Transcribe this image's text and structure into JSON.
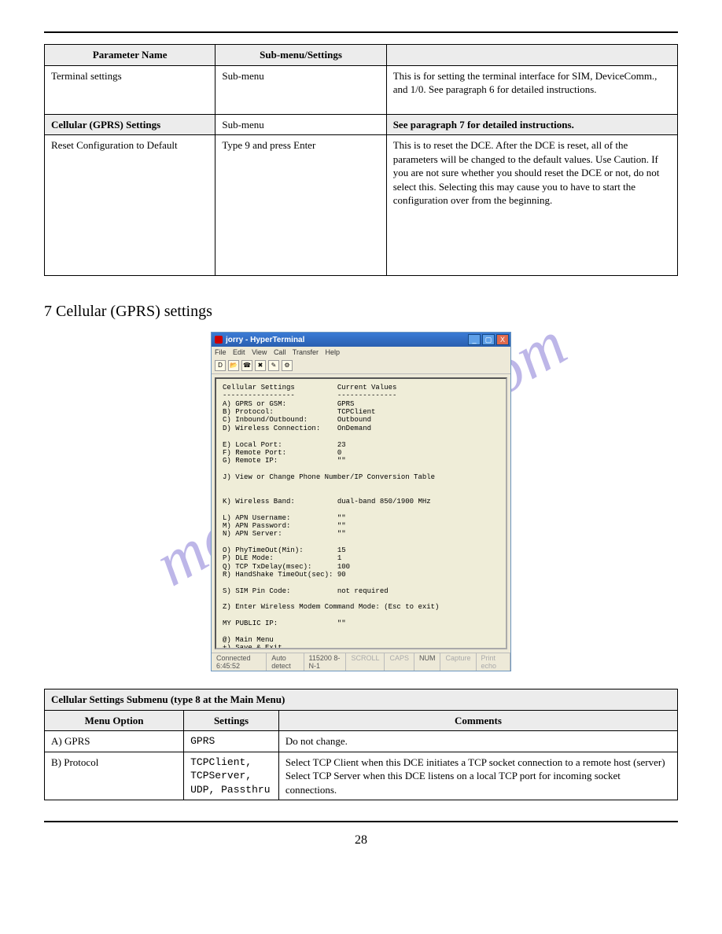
{
  "page_number": "28",
  "table1": {
    "headers": [
      "Parameter Name",
      "Sub-menu/Settings",
      ""
    ],
    "rows": [
      {
        "c1": "Terminal settings",
        "c2": "Sub-menu",
        "c3": "This is for setting the terminal interface for SIM, DeviceComm., and 1/0. See paragraph 6 for detailed instructions."
      },
      {
        "c1": "Cellular (GPRS) Settings",
        "c2": "Sub-menu",
        "c3": "See paragraph 7 for detailed instructions.",
        "header_c1": true,
        "header_c3": true
      },
      {
        "c1": "Reset Configuration to Default",
        "c2": "Type 9 and press Enter",
        "c3": "This is to reset the DCE. After the DCE is reset, all of the parameters will be changed to the default values. Use Caution. If you are not sure whether you should reset the DCE or not, do not select this. Selecting this may cause you to have to start the configuration over from the beginning."
      }
    ]
  },
  "section_heading": "7  Cellular (GPRS) settings",
  "table2": {
    "header_span": "Cellular Settings Submenu (type 8 at the Main Menu)",
    "headers": [
      "Menu Option",
      "Settings",
      "Comments"
    ],
    "rows": [
      {
        "c1": "A) GPRS",
        "c2": "GPRS",
        "c3": "Do not change."
      },
      {
        "c1": "B) Protocol",
        "c2": "TCPClient, TCPServer, UDP, Passthru",
        "c3": "Select TCP Client when this DCE initiates a TCP socket connection to a remote host (server)\nSelect TCP Server when this DCE listens on a local TCP port for incoming socket connections."
      }
    ]
  },
  "term": {
    "title": "jorry - HyperTerminal",
    "menus": [
      "File",
      "Edit",
      "View",
      "Call",
      "Transfer",
      "Help"
    ],
    "status": {
      "conn": "Connected 6:45:52",
      "auto": "Auto detect",
      "baud": "115200 8-N-1",
      "scroll": "SCROLL",
      "caps": "CAPS",
      "num": "NUM",
      "capture": "Capture",
      "print": "Print echo"
    },
    "body": "Cellular Settings          Current Values\n-----------------          --------------\nA) GPRS or GSM:            GPRS\nB) Protocol:               TCPClient\nC) Inbound/Outbound:       Outbound\nD) Wireless Connection:    OnDemand\n\nE) Local Port:             23\nF) Remote Port:            0\nG) Remote IP:              \"\"\n\nJ) View or Change Phone Number/IP Conversion Table\n\n\nK) Wireless Band:          dual-band 850/1900 MHz\n\nL) APN Username:           \"\"\nM) APN Password:           \"\"\nN) APN Server:             \"\"\n\nO) PhyTimeOut(Min):        15\nP) DLE Mode:               1\nQ) TCP TxDelay(msec):      100\nR) HandShake TimeOut(sec): 90\n\nS) SIM Pin Code:           not required\n\nZ) Enter Wireless Modem Command Mode: (Esc to exit)\n\nMY PUBLIC IP:              \"\"\n\n@) Main Menu\n+) Save & Exit\n!) Exit, Don't Save Changes\n() Any Other Key To Refresh\n\nEnter option to modify ->"
  }
}
